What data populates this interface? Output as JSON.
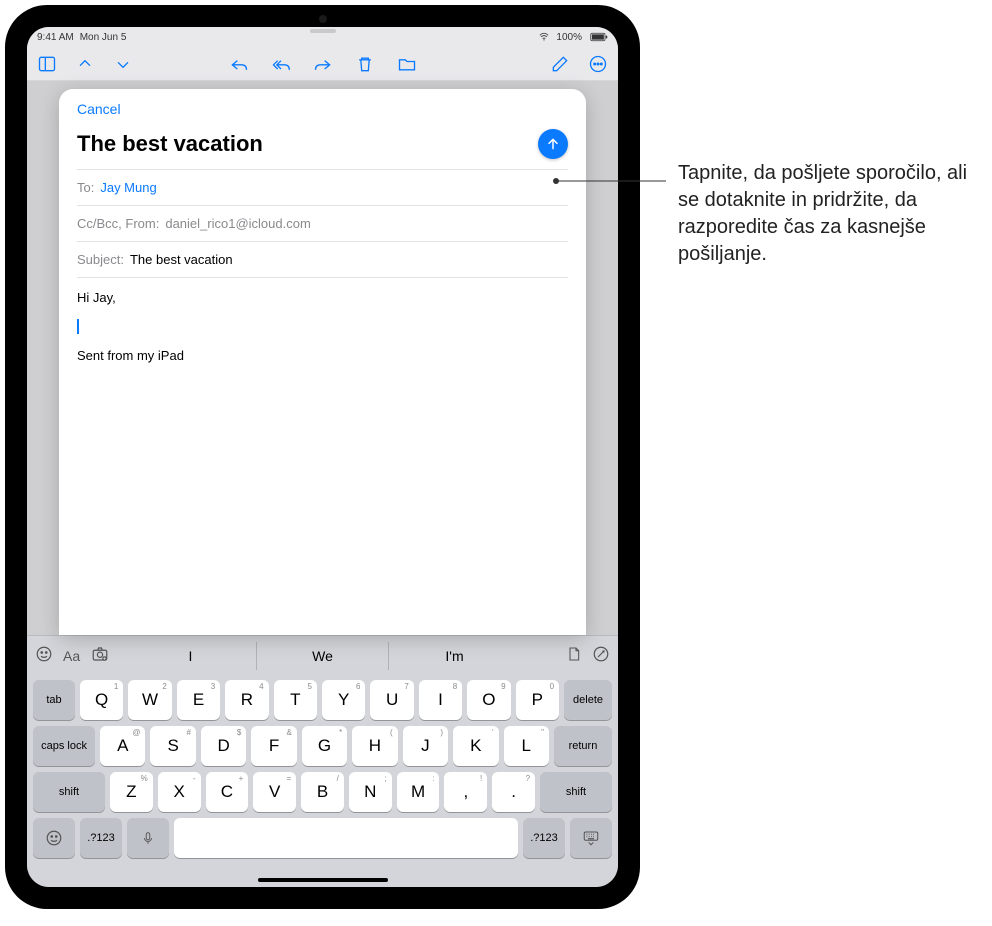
{
  "statusbar": {
    "time": "9:41 AM",
    "date": "Mon Jun 5",
    "battery": "100%"
  },
  "compose": {
    "cancel": "Cancel",
    "title": "The best vacation",
    "to_label": "To:",
    "to_value": "Jay Mung",
    "ccbcc_label": "Cc/Bcc, From:",
    "from_value": "daniel_rico1@icloud.com",
    "subject_label": "Subject:",
    "subject_value": "The best vacation",
    "body_greeting": "Hi Jay,",
    "body_signature": "Sent from my iPad"
  },
  "keyboard": {
    "suggestions": [
      "I",
      "We",
      "I'm"
    ],
    "row1": [
      {
        "k": "Q",
        "s": "1"
      },
      {
        "k": "W",
        "s": "2"
      },
      {
        "k": "E",
        "s": "3"
      },
      {
        "k": "R",
        "s": "4"
      },
      {
        "k": "T",
        "s": "5"
      },
      {
        "k": "Y",
        "s": "6"
      },
      {
        "k": "U",
        "s": "7"
      },
      {
        "k": "I",
        "s": "8"
      },
      {
        "k": "O",
        "s": "9"
      },
      {
        "k": "P",
        "s": "0"
      }
    ],
    "row2": [
      {
        "k": "A",
        "s": "@"
      },
      {
        "k": "S",
        "s": "#"
      },
      {
        "k": "D",
        "s": "$"
      },
      {
        "k": "F",
        "s": "&"
      },
      {
        "k": "G",
        "s": "*"
      },
      {
        "k": "H",
        "s": "("
      },
      {
        "k": "J",
        "s": ")"
      },
      {
        "k": "K",
        "s": "'"
      },
      {
        "k": "L",
        "s": "\""
      }
    ],
    "row3": [
      {
        "k": "Z",
        "s": "%"
      },
      {
        "k": "X",
        "s": "-"
      },
      {
        "k": "C",
        "s": "+"
      },
      {
        "k": "V",
        "s": "="
      },
      {
        "k": "B",
        "s": "/"
      },
      {
        "k": "N",
        "s": ";"
      },
      {
        "k": "M",
        "s": ":"
      },
      {
        "k": ",",
        "s": "!"
      },
      {
        "k": ".",
        "s": "?"
      }
    ],
    "tab": "tab",
    "delete": "delete",
    "caps": "caps lock",
    "return": "return",
    "shift": "shift",
    "numeric": ".?123"
  },
  "kb_mini_icons": {
    "aa": "Aa"
  },
  "callout": "Tapnite, da pošljete sporočilo, ali se dotaknite in pridržite, da razporedite čas za kasnejše pošiljanje."
}
